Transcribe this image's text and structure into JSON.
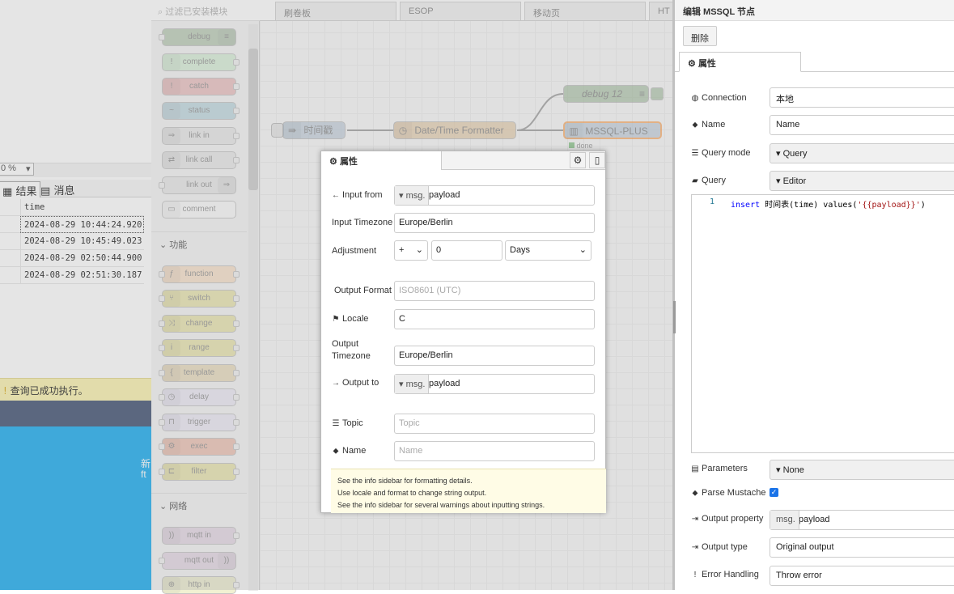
{
  "ssms": {
    "zoom": "0 %",
    "tab_results": "结果",
    "tab_messages": "消息",
    "grid_header": "time",
    "rows": [
      "2024-08-29 10:44:24.920",
      "2024-08-29 10:45:49.023",
      "2024-08-29 02:50:44.900",
      "2024-08-29 02:51:30.187"
    ],
    "status": "查询已成功执行。",
    "desktop_text_1": "新",
    "desktop_text_2": "ft"
  },
  "palette": {
    "filter_placeholder": "过滤已安装模块",
    "common_nodes": [
      "debug",
      "complete",
      "catch",
      "status",
      "link in",
      "link call",
      "link out",
      "comment"
    ],
    "category_function": "功能",
    "function_nodes": [
      "function",
      "switch",
      "change",
      "range",
      "template",
      "delay",
      "trigger",
      "exec",
      "filter"
    ],
    "category_network": "网络",
    "network_nodes": [
      "mqtt in",
      "mqtt out",
      "http in"
    ]
  },
  "workspace": {
    "tabs": [
      "刷卷板",
      "ESOP",
      "移动页",
      "HT"
    ],
    "nodes": {
      "inject": "时间戳",
      "formatter": "Date/Time Formatter",
      "debug": "debug 12",
      "mssql": "MSSQL-PLUS",
      "status": "done"
    }
  },
  "dialog": {
    "tab": "属性",
    "input_from_label": "Input from",
    "input_from_type": "msg.",
    "input_from_value": "payload",
    "input_tz_label": "Input Timezone",
    "input_tz_value": "Europe/Berlin",
    "adjustment_label": "Adjustment",
    "adj_sign": "+",
    "adj_value": "0",
    "adj_unit": "Days",
    "output_format_label": "Output Format",
    "output_format_placeholder": "ISO8601 (UTC)",
    "locale_label": "Locale",
    "locale_value": "C",
    "output_tz_label_1": "Output",
    "output_tz_label_2": "Timezone",
    "output_tz_value": "Europe/Berlin",
    "output_to_label": "Output to",
    "output_to_type": "msg.",
    "output_to_value": "payload",
    "topic_label": "Topic",
    "topic_placeholder": "Topic",
    "name_label": "Name",
    "name_placeholder": "Name",
    "info": [
      "See the info sidebar for formatting details.",
      "Use locale and format to change string output.",
      "See the info sidebar for several warnings about inputting strings."
    ]
  },
  "editor": {
    "title": "编辑 MSSQL 节点",
    "delete": "删除",
    "tab": "属性",
    "connection_label": "Connection",
    "connection_value": "本地",
    "name_label": "Name",
    "name_placeholder": "Name",
    "query_mode_label": "Query mode",
    "query_mode_value": "Query",
    "query_label": "Query",
    "query_value": "Editor",
    "code_line_no": "1",
    "code_kw": "insert",
    "code_table": " 时间表",
    "code_col": "(time)",
    "code_values": " values(",
    "code_str": "'{{payload}}'",
    "code_end": ")",
    "params_label": "Parameters",
    "params_value": "None",
    "mustache_label": "Parse Mustache",
    "output_prop_label": "Output property",
    "output_prop_type": "msg.",
    "output_prop_value": "payload",
    "output_type_label": "Output type",
    "output_type_value": "Original output",
    "error_label": "Error Handling",
    "error_value": "Throw error"
  },
  "colors": {
    "debug": "#87a980",
    "complete": "#c0edc0",
    "catch": "#e49191",
    "status": "#94c1d0",
    "link": "#dddddd",
    "function": "#fdd0a2",
    "change": "#e2d96e",
    "exec": "#e9967a",
    "mqtt": "#d8bfd8",
    "mssql": "#a6bbcf"
  }
}
